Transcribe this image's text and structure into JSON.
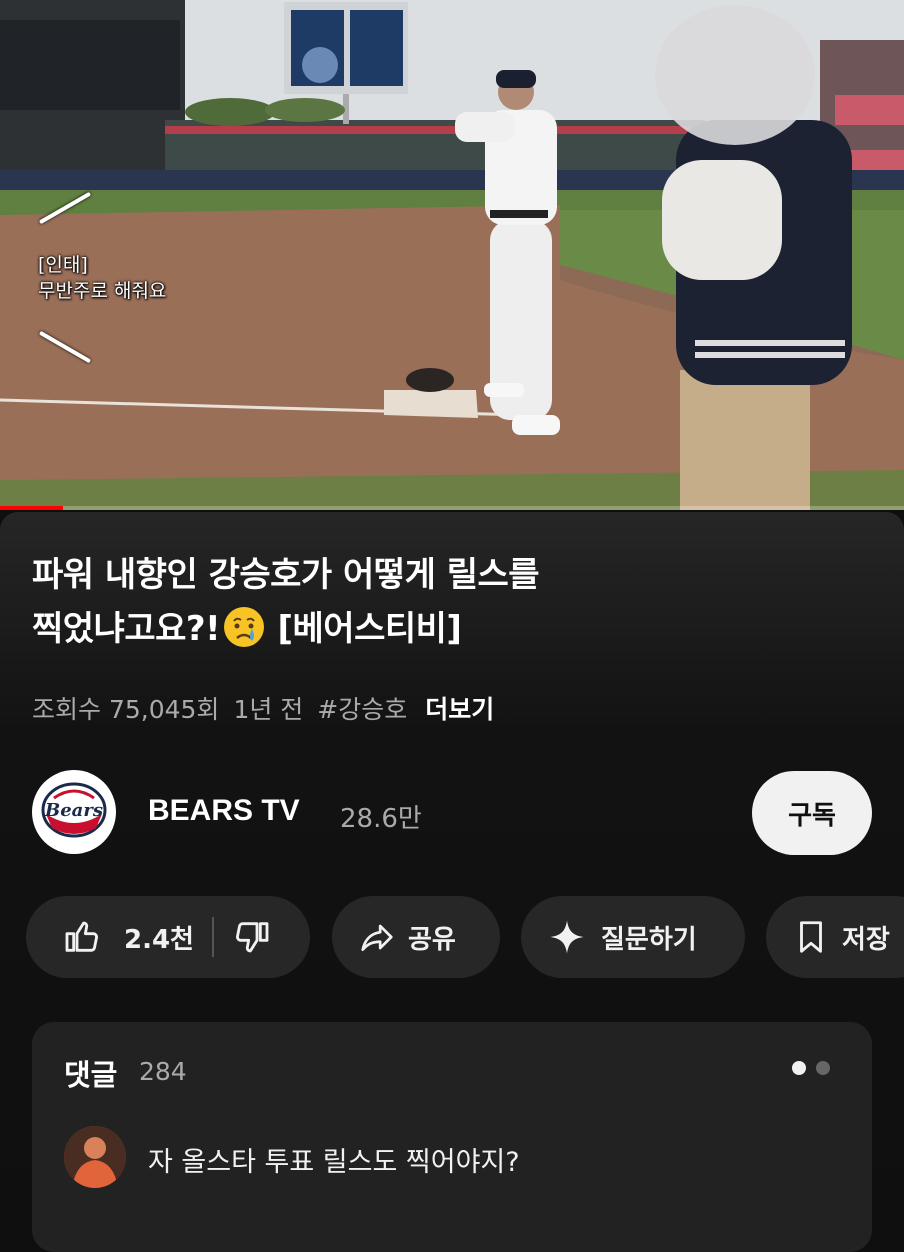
{
  "player": {
    "caption_speaker": "[인태]",
    "caption_text": "무반주로 해줘요",
    "progress_fraction": 0.07
  },
  "video": {
    "title_line1": "파워 내향인 강승호가 어떻게 릴스를",
    "title_line2_a": "찍었냐고요?!",
    "title_line2_b": "[베어스티비]",
    "title_emoji": "crying-face-emoji",
    "views": "조회수 75,045회",
    "age": "1년 전",
    "hashtag": "#강승호",
    "more_label": "더보기"
  },
  "channel": {
    "name": "BEARS TV",
    "subscribers": "28.6만",
    "subscribe_label": "구독"
  },
  "actions": {
    "like_count": "2.4천",
    "share_label": "공유",
    "ask_label": "질문하기",
    "save_label": "저장"
  },
  "comments": {
    "title": "댓글",
    "count": "284",
    "top_comment": "자 올스타 투표 릴스도 찍어야지?",
    "pager_total": 2,
    "pager_active": 0
  },
  "colors": {
    "background": "#0f0f0f",
    "pill": "#272727",
    "subscribe_bg": "#f1f1f1",
    "progress": "#ff0000",
    "secondary_text": "#aaaaaa"
  }
}
